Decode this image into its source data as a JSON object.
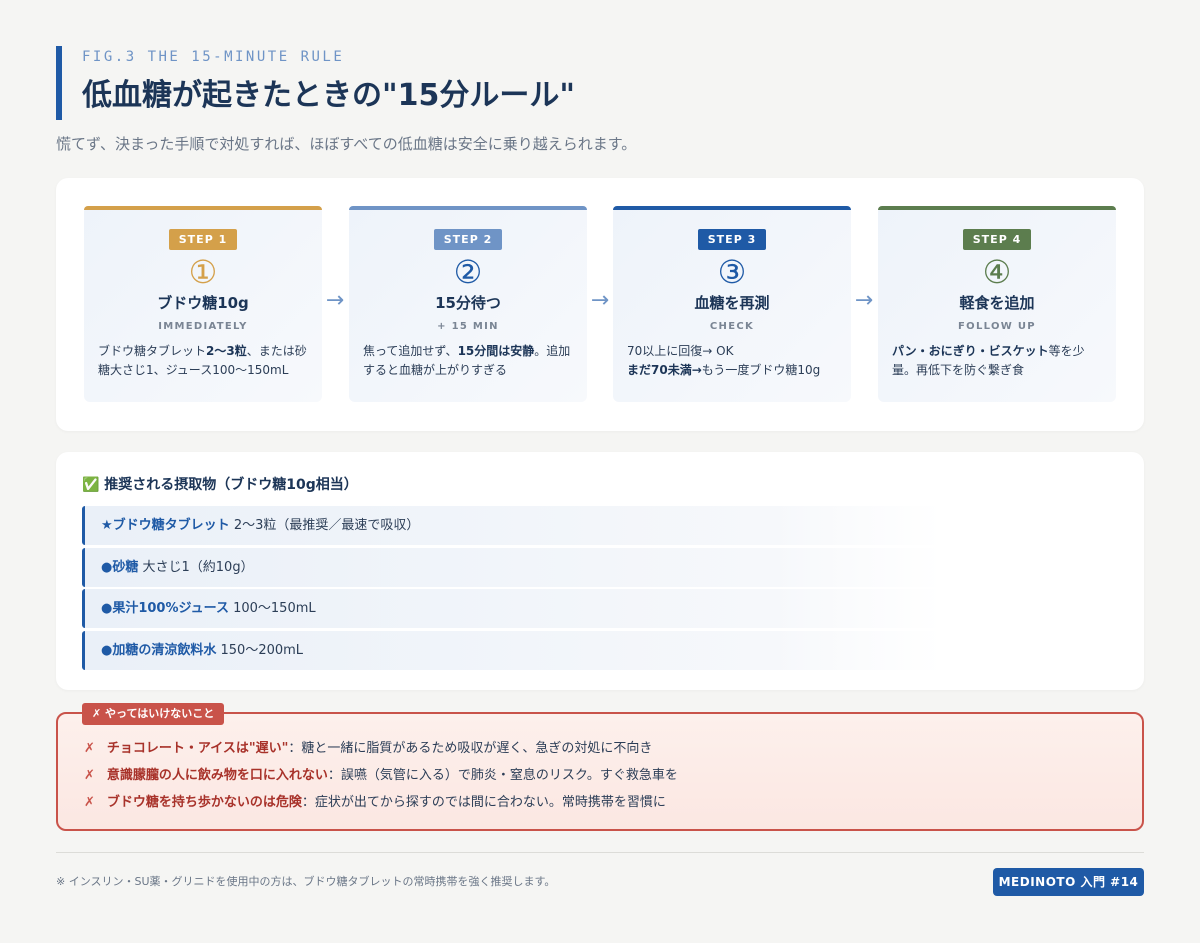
{
  "header": {
    "fig_label": "FIG.3 THE 15-MINUTE RULE",
    "title": "低血糖が起きたときの\"15分ルール\"",
    "subtitle": "慌てず、決まった手順で対処すれば、ほぼすべての低血糖は安全に乗り越えられます。"
  },
  "steps": [
    {
      "badge": "STEP 1",
      "num": "①",
      "title": "ブドウ糖10g",
      "sub": "IMMEDIATELY",
      "desc": [
        "ブドウ糖タブレット",
        "2〜3粒",
        "、または砂糖大さじ1、ジュース100〜150mL"
      ],
      "color": "#d4a04a"
    },
    {
      "badge": "STEP 2",
      "num": "②",
      "title": "15分待つ",
      "sub": "+ 15 MIN",
      "desc": [
        "焦って追加せず、",
        "15分間は安静",
        "。追加すると血糖が上がりすぎる"
      ],
      "color": "#6f94c6"
    },
    {
      "badge": "STEP 3",
      "num": "③",
      "title": "血糖を再測",
      "sub": "CHECK",
      "desc": [
        "70以上に回復→ OK",
        "まだ70未満→",
        "もう一度ブドウ糖10g"
      ],
      "color": "#1f5aa6"
    },
    {
      "badge": "STEP 4",
      "num": "④",
      "title": "軽食を追加",
      "sub": "FOLLOW UP",
      "desc": [
        "パン・おにぎり・ビスケット",
        "等を少量。再低下を防ぐ繋ぎ食"
      ],
      "color": "#5c7d4e"
    }
  ],
  "arrows": [
    "→",
    "→",
    "→"
  ],
  "foods": {
    "heading": "✅ 推奨される摂取物（ブドウ糖10g相当）",
    "items": [
      {
        "marker": "★",
        "name": "ブドウ糖タブレット",
        "amount": "2〜3粒（最推奨／最速で吸収）"
      },
      {
        "marker": "●",
        "name": "砂糖",
        "amount": "大さじ1（約10g）"
      },
      {
        "marker": "●",
        "name": "果汁100%ジュース",
        "amount": "100〜150mL"
      },
      {
        "marker": "●",
        "name": "加糖の清涼飲料水",
        "amount": "150〜200mL"
      }
    ]
  },
  "warnings": {
    "badge": "✗ やってはいけないこと",
    "mark": "✗",
    "items": [
      {
        "strong": "チョコレート・アイスは\"遅い\"",
        "text": "：糖と一緒に脂質があるため吸収が遅く、急ぎの対処に不向き"
      },
      {
        "strong": "意識朦朧の人に飲み物を口に入れない",
        "text": "：誤嚥（気管に入る）で肺炎・窒息のリスク。すぐ救急車を"
      },
      {
        "strong": "ブドウ糖を持ち歩かないのは危険",
        "text": "：症状が出てから探すのでは間に合わない。常時携帯を習慣に"
      }
    ]
  },
  "footer": {
    "note": "※ インスリン・SU薬・グリニドを使用中の方は、ブドウ糖タブレットの常時携帯を強く推奨します。",
    "brand": "MEDINOTO 入門 #14"
  }
}
